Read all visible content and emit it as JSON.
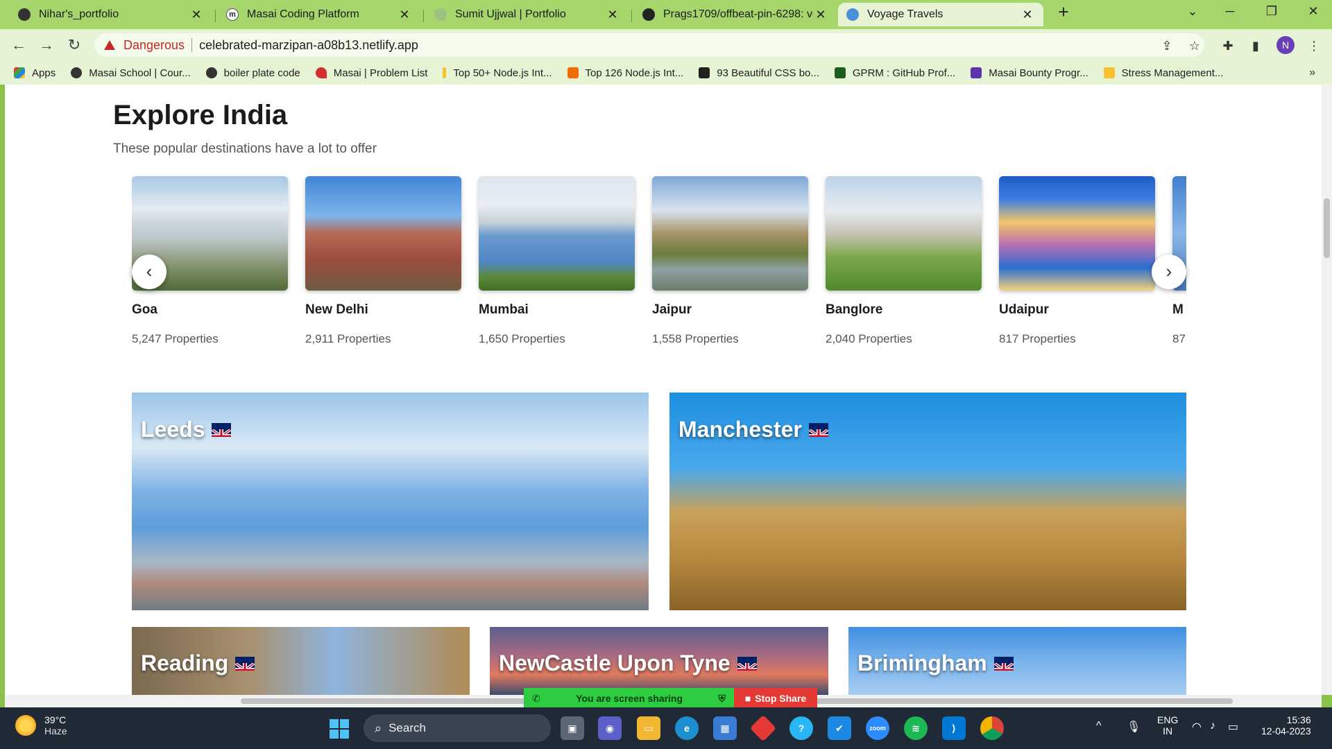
{
  "tabs": [
    {
      "label": "Nihar's_portfolio",
      "icon": "globe-icon",
      "active": false
    },
    {
      "label": "Masai Coding Platform",
      "icon": "masai-m-icon",
      "active": false
    },
    {
      "label": "Sumit Ujjwal | Portfolio",
      "icon": "page-icon",
      "active": false
    },
    {
      "label": "Prags1709/offbeat-pin-6298: voy",
      "icon": "github-icon",
      "active": false
    },
    {
      "label": "Voyage Travels",
      "icon": "globe-icon",
      "active": true
    }
  ],
  "omnibox": {
    "security_label": "Dangerous",
    "url": "celebrated-marzipan-a08b13.netlify.app"
  },
  "profile_initial": "N",
  "bookmarks": [
    {
      "label": "Apps",
      "color": "#e53935"
    },
    {
      "label": "Masai School | Cour...",
      "color": "#333333"
    },
    {
      "label": "boiler plate code",
      "color": "#333333"
    },
    {
      "label": "Masai | Problem List",
      "color": "#d32f2f"
    },
    {
      "label": "Top 50+ Node.js Int...",
      "color": "#fbc02d"
    },
    {
      "label": "Top 126 Node.js Int...",
      "color": "#ef6c00"
    },
    {
      "label": "93 Beautiful CSS bo...",
      "color": "#212121"
    },
    {
      "label": "GPRM : GitHub Prof...",
      "color": "#1b5e20"
    },
    {
      "label": "Masai Bounty Progr...",
      "color": "#5e35b1"
    },
    {
      "label": "Stress Management...",
      "color": "#fbc02d"
    }
  ],
  "explore": {
    "title": "Explore India",
    "subtitle": "These popular destinations have a lot to offer",
    "destinations": [
      {
        "name": "Goa",
        "properties": "5,247 Properties"
      },
      {
        "name": "New Delhi",
        "properties": "2,911 Properties"
      },
      {
        "name": "Mumbai",
        "properties": "1,650 Properties"
      },
      {
        "name": "Jaipur",
        "properties": "1,558 Properties"
      },
      {
        "name": "Banglore",
        "properties": "2,040 Properties"
      },
      {
        "name": "Udaipur",
        "properties": "817 Properties"
      },
      {
        "name": "M",
        "properties": "87"
      }
    ]
  },
  "cities": [
    {
      "name": "Leeds"
    },
    {
      "name": "Manchester"
    },
    {
      "name": "Reading"
    },
    {
      "name": "NewCastle Upon Tyne"
    },
    {
      "name": "Brimingham"
    }
  ],
  "screen_share": {
    "status": "You are screen sharing",
    "stop_label": "Stop Share"
  },
  "taskbar": {
    "temperature": "39°C",
    "condition": "Haze",
    "search_label": "Search",
    "lang_top": "ENG",
    "lang_bottom": "IN",
    "time": "15:36",
    "date": "12-04-2023"
  }
}
